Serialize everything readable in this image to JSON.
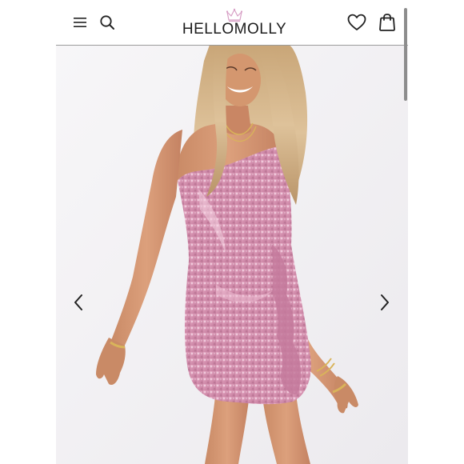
{
  "header": {
    "brand": "HELLOMOLLY",
    "menu_icon": "hamburger-menu-icon",
    "search_icon": "search-icon",
    "wishlist_icon": "heart-icon",
    "bag_icon": "shopping-bag-icon"
  },
  "gallery": {
    "image": "model-in-pink-sequin-one-shoulder-mini-dress",
    "prev_icon": "chevron-left-icon",
    "next_icon": "chevron-right-icon"
  },
  "colors": {
    "dress": "#d89ab4",
    "background": "#f4f3f6",
    "crown": "#d8a0c6"
  }
}
